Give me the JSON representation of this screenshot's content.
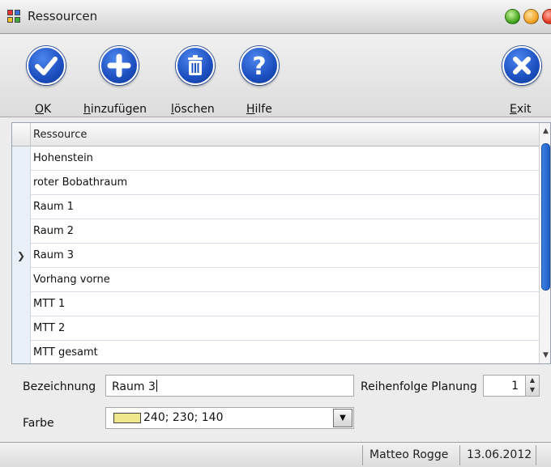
{
  "window": {
    "title": "Ressourcen"
  },
  "toolbar": {
    "ok": {
      "underline": "O",
      "rest": "K"
    },
    "add": {
      "underline": "h",
      "rest": "inzufügen"
    },
    "delete": {
      "underline": "l",
      "rest": "öschen"
    },
    "help": {
      "underline": "H",
      "rest": "ilfe"
    },
    "exit": {
      "underline": "E",
      "rest": "xit"
    }
  },
  "table": {
    "header": "Ressource",
    "rows": [
      "Hohenstein",
      "roter Bobathraum",
      "Raum 1",
      "Raum 2",
      "Raum 3",
      "Vorhang vorne",
      "MTT 1",
      "MTT 2",
      "MTT gesamt"
    ],
    "selected_row": "Raum 3"
  },
  "form": {
    "name_label": "Bezeichnung",
    "name_value": "Raum 3",
    "order_label": "Reihenfolge Planung",
    "order_value": "1",
    "color_label": "Farbe",
    "color_value": "240; 230; 140",
    "color_swatch": "#f0e68c"
  },
  "status": {
    "user": "Matteo Rogge",
    "date": "13.06.2012"
  },
  "colors": {
    "accent": "#1c4fbf"
  }
}
